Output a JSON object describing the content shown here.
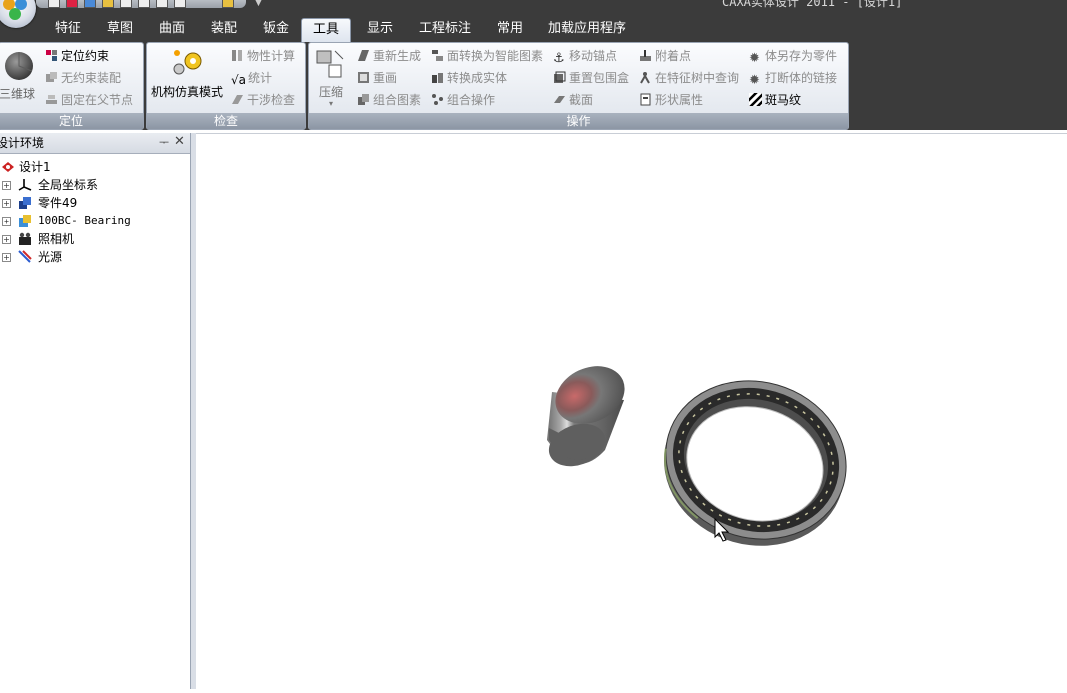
{
  "window": {
    "title": "CAXA实体设计 2011 - [设计1]"
  },
  "tabs": [
    {
      "label": "特征"
    },
    {
      "label": "草图"
    },
    {
      "label": "曲面"
    },
    {
      "label": "装配"
    },
    {
      "label": "钣金"
    },
    {
      "label": "工具",
      "active": true
    },
    {
      "label": "显示"
    },
    {
      "label": "工程标注"
    },
    {
      "label": "常用"
    },
    {
      "label": "加载应用程序"
    }
  ],
  "ribbon": {
    "positioning": {
      "title": "定位",
      "large_button": "三维球",
      "items": [
        {
          "label": "定位约束",
          "enabled": true
        },
        {
          "label": "无约束装配",
          "enabled": false
        },
        {
          "label": "固定在父节点",
          "enabled": false
        }
      ]
    },
    "inspect": {
      "title": "检查",
      "large_button": "机构仿真模式",
      "items": [
        {
          "label": "物性计算",
          "enabled": false
        },
        {
          "label": "统计",
          "enabled": false
        },
        {
          "label": "干涉检查",
          "enabled": false
        }
      ]
    },
    "operations": {
      "title": "操作",
      "large_button": "压缩",
      "col1": [
        {
          "label": "重新生成",
          "enabled": false
        },
        {
          "label": "重画",
          "enabled": false
        },
        {
          "label": "组合图素",
          "enabled": false
        }
      ],
      "col2": [
        {
          "label": "面转换为智能图素",
          "enabled": false
        },
        {
          "label": "转换成实体",
          "enabled": false
        },
        {
          "label": "组合操作",
          "enabled": false
        }
      ],
      "col3": [
        {
          "label": "移动锚点",
          "enabled": false
        },
        {
          "label": "重置包围盒",
          "enabled": false
        },
        {
          "label": "截面",
          "enabled": false
        }
      ],
      "col4": [
        {
          "label": "附着点",
          "enabled": false
        },
        {
          "label": "在特征树中查询",
          "enabled": false
        },
        {
          "label": "形状属性",
          "enabled": false
        }
      ],
      "col5": [
        {
          "label": "体另存为零件",
          "enabled": false
        },
        {
          "label": "打断体的链接",
          "enabled": false
        },
        {
          "label": "斑马纹",
          "enabled": true
        }
      ]
    }
  },
  "panel": {
    "title": "设计环境",
    "tree": [
      {
        "label": "设计1",
        "icon": "design-icon"
      },
      {
        "label": "全局坐标系",
        "icon": "axes-icon"
      },
      {
        "label": "零件49",
        "icon": "part-icon"
      },
      {
        "label": "100BC- Bearing",
        "icon": "bearing-icon"
      },
      {
        "label": "照相机",
        "icon": "camera-icon"
      },
      {
        "label": "光源",
        "icon": "light-icon"
      }
    ]
  },
  "colors": {
    "ribbon_bg": "#3b3b3b",
    "group_title_bg": "#8c96a4",
    "active_tab": "#f7f9fc"
  }
}
